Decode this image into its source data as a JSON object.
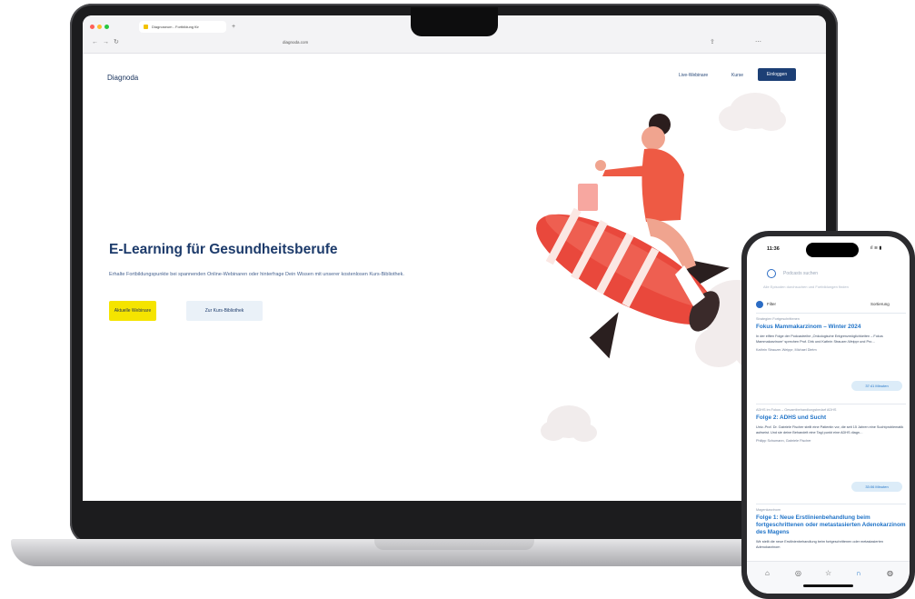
{
  "browser": {
    "tab_title": "Diagnoseum - Fortbildung für",
    "new_tab": "+",
    "address": "diagnoda.com"
  },
  "site": {
    "logo": "Diagnoda",
    "nav": {
      "webinars": "Live-Webinare",
      "kurse": "Kurse",
      "login": "Einloggen"
    },
    "hero": {
      "title": "E-Learning für Gesundheitsberufe",
      "subtitle": "Erhalte Fortbildungspunkte bei spannenden Online-Webinaren oder hinterfrage Dein Wissen mit unserer kostenlosen Kurs-Bibliothek.",
      "cta_primary": "Aktuelle Webinare",
      "cta_secondary": "Zur Kurs-Bibliothek"
    }
  },
  "phone": {
    "time": "11:36",
    "status": "ıl ≋ ▮",
    "search_placeholder": "Podcasts suchen",
    "search_hint": "Alle Episoden durchsuchen und Fortbildungen finden",
    "filter": "Filter",
    "sort": "Sortierung",
    "episodes": [
      {
        "category": "Strategien Fortgeschrittenen",
        "title": "Fokus Mammakarzinom – Winter 2024",
        "description": "In der elften Folge der Podcastreihe „Onkologische Entgrenzmöglichkeiten – Fokus Mammakarzinom“ sprechen Prof. Dirk und Kathrin Strauzer-Weippr und Pro…",
        "authors": "Kathrin Strauzer-Weippr, Michael Dietm",
        "duration": "37:41 Minuten"
      },
      {
        "category": "ADHS im Fokus – Gesamtbehandlungsbedarf ADHS",
        "title": "Folge 2: ADHS und Sucht",
        "description": "Univ.-Prof. Dr. Gabriele Fischer stellt eine Patientin vor, die seit 15 Jahren eine Suchtproblematik aufweist. Und sie deine Behandelt eine Tagl punkt eine ADHS diagn…",
        "authors": "Philipp Schumann, Gabriele Fischer",
        "duration": "33:06 Minuten"
      },
      {
        "category": "Magenkarzinom",
        "title": "Folge 1: Neue Erstlinienbehandlung beim fortgeschrittenen oder metastasierten Adenokarzinom des Magens",
        "description": "Wir stellt die neue Erstlinienbehandlung beim fortgeschrittenen oder metastasierten Adenokarzinom"
      }
    ],
    "tabbar_icons": [
      "home-icon",
      "compass-icon",
      "star-icon",
      "headphones-icon",
      "profile-icon"
    ]
  },
  "colors": {
    "navy": "#1c3f75",
    "yellow": "#f5e400",
    "link_blue": "#2174c8",
    "rocket_red": "#e9483c"
  }
}
